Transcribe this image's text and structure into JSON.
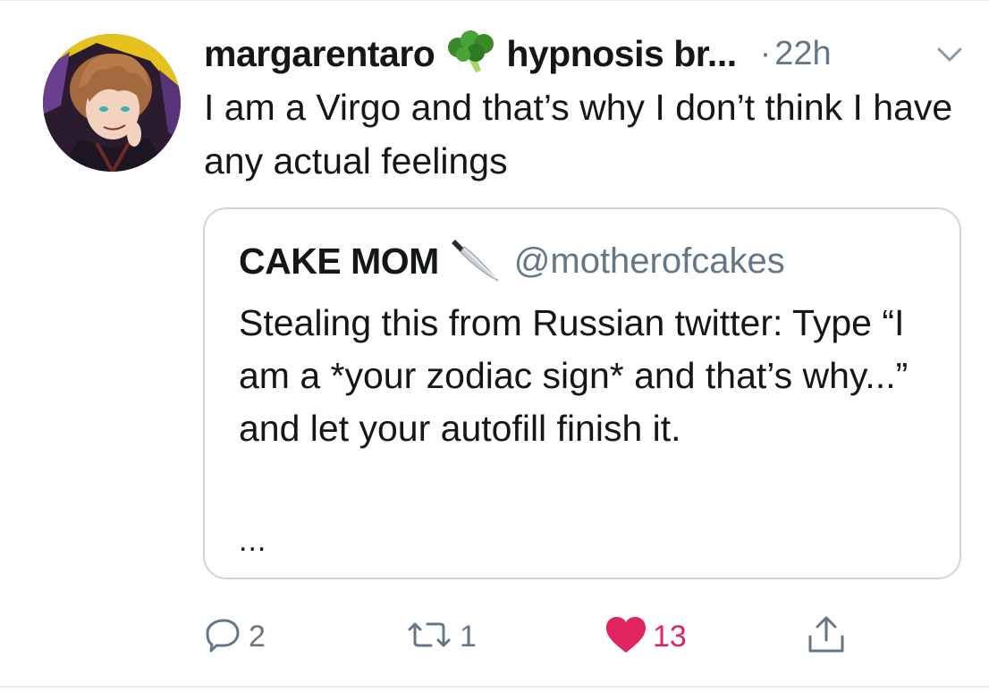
{
  "tweet": {
    "display_name": "margarentaro",
    "name_suffix": "hypnosis br...",
    "meta_dot": "·",
    "timestamp": "22h",
    "text": "I am a Virgo and that’s why I don’t think I have any actual feelings",
    "name_emoji_icon": "broccoli-icon",
    "menu_icon": "chevron-down-icon"
  },
  "quoted": {
    "display_name": "CAKE MOM",
    "name_emoji_icon": "knife-icon",
    "handle": "@motherofcakes",
    "text": "Stealing this from Russian twitter: Type “I am a *your zodiac sign* and that’s why...” and let your autofill finish it.",
    "more": "..."
  },
  "actions": {
    "reply": {
      "icon": "reply-icon",
      "count": "2"
    },
    "retweet": {
      "icon": "retweet-icon",
      "count": "1"
    },
    "like": {
      "icon": "heart-icon",
      "count": "13",
      "color": "#e0245e"
    },
    "share": {
      "icon": "share-icon"
    }
  },
  "colors": {
    "text": "#14171a",
    "secondary": "#657786",
    "border": "#ccd6dd",
    "like": "#e0245e"
  }
}
